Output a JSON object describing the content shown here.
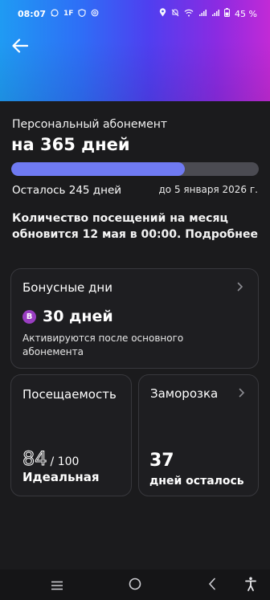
{
  "status_bar": {
    "time": "08:07",
    "left_icons": [
      "whatsapp-icon",
      "1f-icon",
      "shield-icon",
      "threads-icon"
    ],
    "right_icons": [
      "location-icon",
      "mute-icon",
      "wifi-icon",
      "signal-icon",
      "signal-icon-2",
      "battery-icon"
    ],
    "battery": "45 %"
  },
  "header": {
    "back_icon": "arrow-left-icon",
    "gradient": [
      "#1f9bf3",
      "#4f3ff0",
      "#c22ad6"
    ]
  },
  "subscription": {
    "subtitle": "Персональный абонемент",
    "title": "на 365 дней",
    "progress_fraction": 0.7,
    "remaining": "Осталось 245 дней",
    "until": "до 5 января 2026 г.",
    "notice": "Количество посещений на месяц обновится 12 мая в 00:00. Подробнее"
  },
  "bonus": {
    "title": "Бонусные дни",
    "badge": "B",
    "value": "30 дней",
    "note": "Активируются после основного абонемента"
  },
  "attendance": {
    "title": "Посещаемость",
    "score": "84",
    "of": "/ 100",
    "label": "Идеальная"
  },
  "freeze": {
    "title": "Заморозка",
    "value": "37",
    "label": "дней осталось"
  },
  "colors": {
    "background": "#1b1b1d",
    "card": "#1e1e21",
    "progress_fill": "#6f7af2",
    "progress_track": "#4b4b52",
    "badge": "#9a3ec2"
  },
  "nav": [
    "recent-apps-icon",
    "home-icon",
    "back-icon",
    "accessibility-icon"
  ]
}
